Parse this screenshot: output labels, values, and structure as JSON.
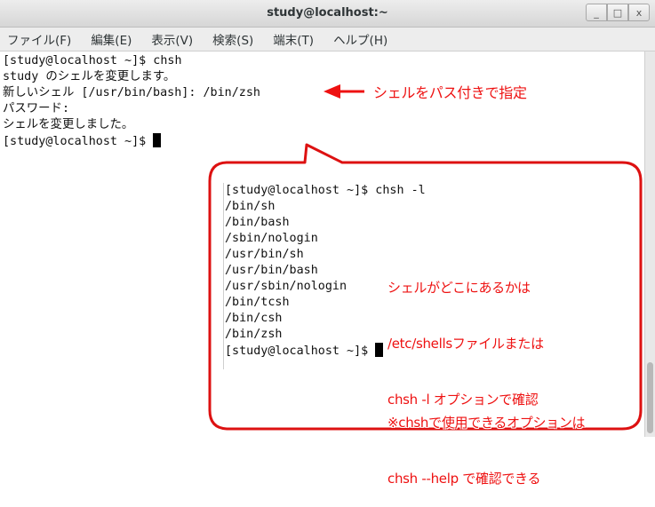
{
  "window": {
    "title": "study@localhost:~",
    "buttons": [
      "_",
      "□",
      "x"
    ]
  },
  "menu": [
    "ファイル(F)",
    "編集(E)",
    "表示(V)",
    "検索(S)",
    "端末(T)",
    "ヘルプ(H)"
  ],
  "terminal": {
    "lines": [
      "[study@localhost ~]$ chsh",
      "study のシェルを変更します。",
      "新しいシェル [/usr/bin/bash]: /bin/zsh",
      "パスワード:",
      "シェルを変更しました。",
      "[study@localhost ~]$ "
    ]
  },
  "inset": {
    "lines": [
      "[study@localhost ~]$ chsh -l",
      "/bin/sh",
      "/bin/bash",
      "/sbin/nologin",
      "/usr/bin/sh",
      "/usr/bin/bash",
      "/usr/sbin/nologin",
      "/bin/tcsh",
      "/bin/csh",
      "/bin/zsh",
      "[study@localhost ~]$ "
    ]
  },
  "annotations": {
    "arrow_note": "シェルをパス付きで指定",
    "note1": [
      "シェルがどこにあるかは",
      "/etc/shellsファイルまたは",
      "chsh -l オプションで確認"
    ],
    "note2": [
      "※chshで使用できるオプションは",
      "chsh --help で確認できる"
    ],
    "color": "#ee1111"
  }
}
